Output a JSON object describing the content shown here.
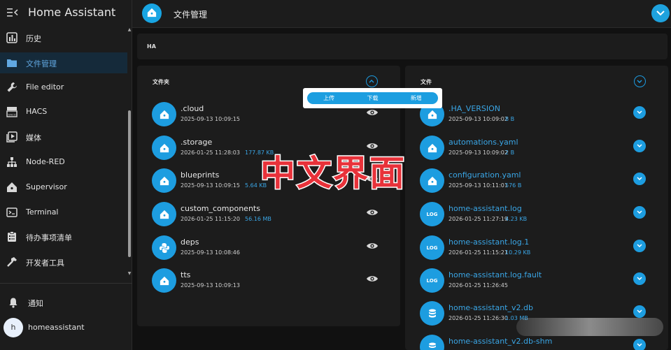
{
  "app": {
    "title": "Home Assistant"
  },
  "sidebar": {
    "items": [
      {
        "label": "历史",
        "icon": "chart-icon"
      },
      {
        "label": "文件管理",
        "icon": "folder-icon",
        "active": true
      },
      {
        "label": "File editor",
        "icon": "wrench-icon"
      },
      {
        "label": "HACS",
        "icon": "hacs-icon"
      },
      {
        "label": "媒体",
        "icon": "play-box-icon"
      },
      {
        "label": "Node-RED",
        "icon": "sitemap-icon"
      },
      {
        "label": "Supervisor",
        "icon": "home-assistant-icon"
      },
      {
        "label": "Terminal",
        "icon": "console-icon"
      },
      {
        "label": "待办事项清单",
        "icon": "clipboard-list-icon"
      },
      {
        "label": "开发者工具",
        "icon": "hammer-icon"
      }
    ],
    "notifications_label": "通知",
    "user": {
      "name": "homeassistant",
      "initial": "h"
    }
  },
  "topbar": {
    "title": "文件管理"
  },
  "path": {
    "text": "HA"
  },
  "folders": {
    "header": "文件夹",
    "rows": [
      {
        "name": ".cloud",
        "date": "2025-09-13 10:09:15",
        "size": "",
        "icon": "home-assistant-icon"
      },
      {
        "name": ".storage",
        "date": "2026-01-25 11:28:03",
        "size": "177.87 KB",
        "icon": "home-assistant-icon"
      },
      {
        "name": "blueprints",
        "date": "2025-09-13 10:09:15",
        "size": "5.64 KB",
        "icon": "home-assistant-icon"
      },
      {
        "name": "custom_components",
        "date": "2026-01-25 11:15:20",
        "size": "56.16 MB",
        "icon": "home-assistant-icon"
      },
      {
        "name": "deps",
        "date": "2025-09-13 10:08:46",
        "size": "",
        "icon": "python-icon"
      },
      {
        "name": "tts",
        "date": "2025-09-13 10:09:13",
        "size": "",
        "icon": "home-assistant-icon"
      }
    ]
  },
  "files": {
    "header": "文件",
    "rows": [
      {
        "name": ".HA_VERSION",
        "date": "2025-09-13 10:09:02",
        "size": "8 B",
        "icon": "home-assistant-icon"
      },
      {
        "name": "automations.yaml",
        "date": "2025-09-13 10:09:02",
        "size": "2 B",
        "icon": "home-assistant-icon"
      },
      {
        "name": "configuration.yaml",
        "date": "2025-09-13 10:11:01",
        "size": "576 B",
        "icon": "home-assistant-icon"
      },
      {
        "name": "home-assistant.log",
        "date": "2026-01-25 11:27:19",
        "size": "4.23 KB",
        "icon": "log-icon",
        "icon_text": "LOG"
      },
      {
        "name": "home-assistant.log.1",
        "date": "2026-01-25 11:15:21",
        "size": "10.29 KB",
        "icon": "log-icon",
        "icon_text": "LOG"
      },
      {
        "name": "home-assistant.log.fault",
        "date": "2026-01-25 11:26:45",
        "size": "",
        "icon": "log-icon",
        "icon_text": "LOG"
      },
      {
        "name": "home-assistant_v2.db",
        "date": "2026-01-25 11:26:30",
        "size": "1.03 MB",
        "icon": "database-icon"
      },
      {
        "name": "home-assistant_v2.db-shm",
        "date": "",
        "size": "",
        "icon": "database-icon"
      }
    ]
  },
  "popup": {
    "upload": "上传",
    "download": "下载",
    "new": "新增"
  },
  "overlay": {
    "text": "中文界面"
  },
  "colors": {
    "accent": "#1d9de0",
    "active_bg": "#152a3a",
    "overlay_red": "#e8323a"
  }
}
